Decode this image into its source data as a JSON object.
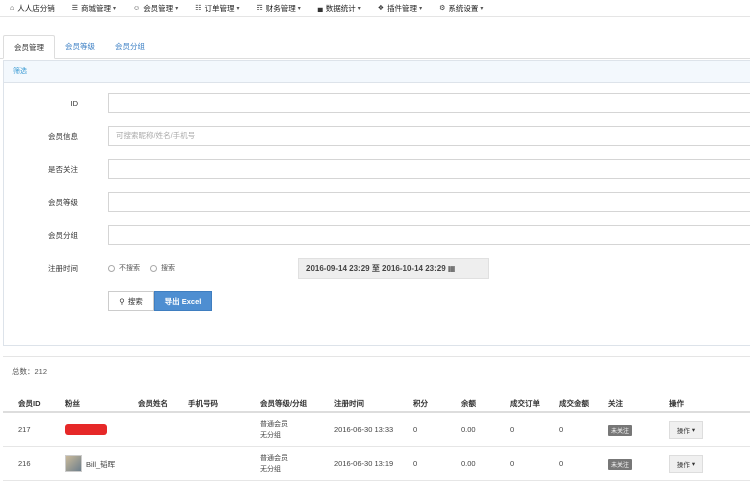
{
  "nav": [
    {
      "icon": "home-icon",
      "glyph": "⌂",
      "label": "人人店分销",
      "caret": false
    },
    {
      "icon": "shop-icon",
      "glyph": "☰",
      "label": "商城管理",
      "caret": true
    },
    {
      "icon": "user-icon",
      "glyph": "☺",
      "label": "会员管理",
      "caret": true
    },
    {
      "icon": "order-icon",
      "glyph": "☷",
      "label": "订单管理",
      "caret": true
    },
    {
      "icon": "finance-icon",
      "glyph": "☶",
      "label": "财务管理",
      "caret": true
    },
    {
      "icon": "chart-icon",
      "glyph": "▄",
      "label": "数据统计",
      "caret": true
    },
    {
      "icon": "plugin-icon",
      "glyph": "❖",
      "label": "插件管理",
      "caret": true
    },
    {
      "icon": "gear-icon",
      "glyph": "⚙",
      "label": "系统设置",
      "caret": true
    }
  ],
  "tabs": [
    "会员管理",
    "会员等级",
    "会员分组"
  ],
  "filter": {
    "title": "筛选",
    "id_label": "ID",
    "info_label": "会员信息",
    "info_placeholder": "可搜索昵称/姓名/手机号",
    "follow_label": "是否关注",
    "level_label": "会员等级",
    "group_label": "会员分组",
    "regtime_label": "注册时间",
    "radio_no": "不搜索",
    "radio_yes": "搜索",
    "date_range": "2016-09-14 23:29 至 2016-10-14 23:29",
    "search_btn": "搜索",
    "export_btn": "导出 Excel"
  },
  "total": "总数：212",
  "table": {
    "headers": [
      "会员ID",
      "粉丝",
      "会员姓名",
      "手机号码",
      "会员等级/分组",
      "注册时间",
      "积分",
      "余额",
      "成交订单",
      "成交金额",
      "关注",
      "操作"
    ],
    "rows": [
      {
        "id": "217",
        "fan": "",
        "level": "普通会员",
        "group": "无分组",
        "regtime": "2016-06-30 13:33",
        "points": "0",
        "balance": "0.00",
        "orders": "0",
        "amount": "0",
        "follow": "未关注",
        "op": "操作"
      },
      {
        "id": "216",
        "fan": "Bill_韬晖",
        "level": "普通会员",
        "group": "无分组",
        "regtime": "2016-06-30 13:19",
        "points": "0",
        "balance": "0.00",
        "orders": "0",
        "amount": "0",
        "follow": "未关注",
        "op": "操作"
      }
    ]
  }
}
